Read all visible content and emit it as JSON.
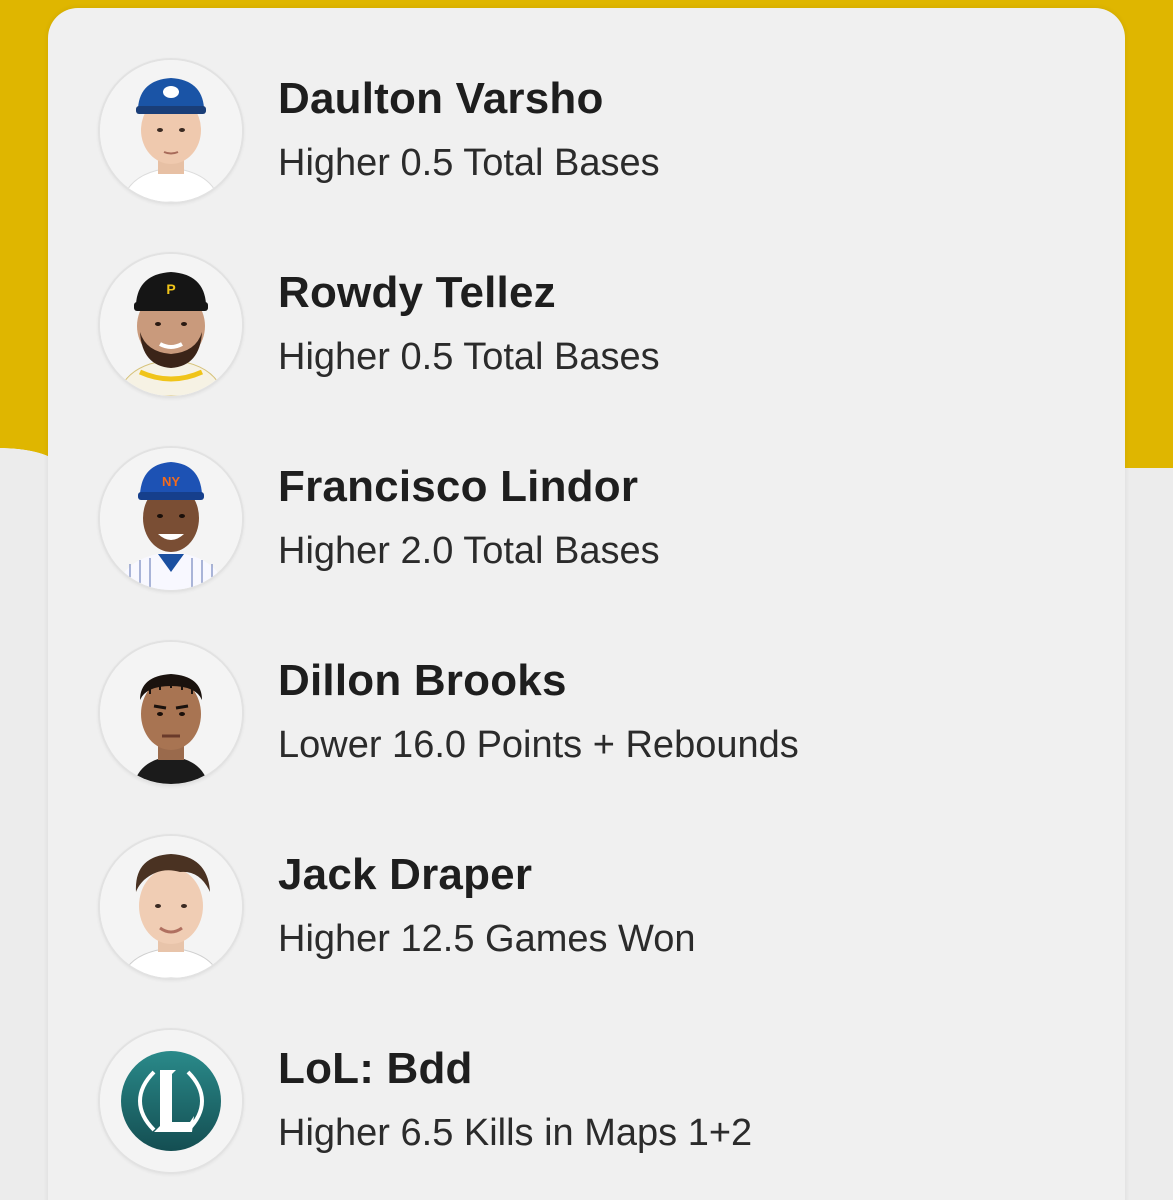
{
  "picks": [
    {
      "name": "Daulton Varsho",
      "pick": "Higher 0.5 Total Bases",
      "avatar": "mlb-player-blue-jays-cap"
    },
    {
      "name": "Rowdy Tellez",
      "pick": "Higher 0.5 Total Bases",
      "avatar": "mlb-player-pirates-cap"
    },
    {
      "name": "Francisco Lindor",
      "pick": "Higher 2.0 Total Bases",
      "avatar": "mlb-player-mets-cap"
    },
    {
      "name": "Dillon Brooks",
      "pick": "Lower 16.0 Points + Rebounds",
      "avatar": "nba-player-headshot"
    },
    {
      "name": "Jack Draper",
      "pick": "Higher 12.5 Games Won",
      "avatar": "tennis-player-headshot"
    },
    {
      "name": "LoL: Bdd",
      "pick": "Higher 6.5 Kills in Maps 1+2",
      "avatar": "league-of-legends-logo"
    }
  ],
  "colors": {
    "accent_yellow": "#dfb600",
    "card_bg": "#f0f0f0",
    "lol_logo": "#1f6e70"
  }
}
